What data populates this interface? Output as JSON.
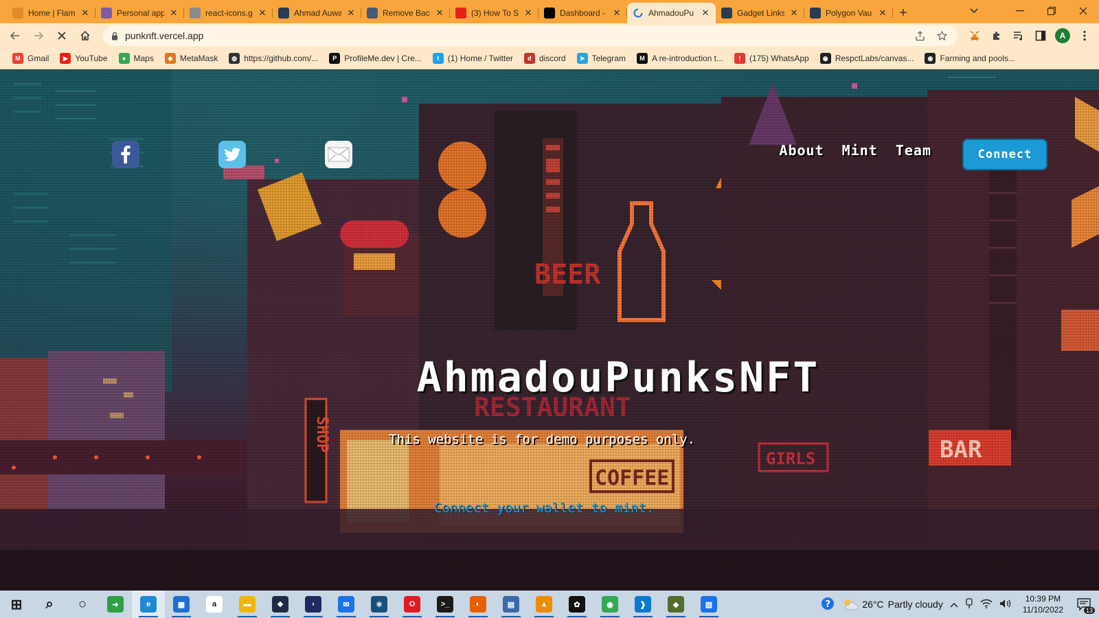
{
  "browser": {
    "tabs": [
      {
        "title": "Home | Flam",
        "favicon": "flame-favicon",
        "color": "#e08a2c",
        "active": false
      },
      {
        "title": "Personal app",
        "favicon": "h-favicon",
        "color": "#7b5ea7",
        "active": false
      },
      {
        "title": "react-icons.g",
        "favicon": "react-icons-favicon",
        "color": "#8a8a8a",
        "active": false
      },
      {
        "title": "Ahmad Auwa",
        "favicon": "gear-favicon",
        "color": "#2b3a55",
        "active": false
      },
      {
        "title": "Remove Bac",
        "favicon": "remove-bg-favicon",
        "color": "#4a5a7a",
        "active": false
      },
      {
        "title": "(3) How To S",
        "favicon": "youtube-favicon",
        "color": "#e62117",
        "active": false
      },
      {
        "title": "Dashboard -",
        "favicon": "vercel-favicon",
        "color": "#000000",
        "active": false
      },
      {
        "title": "AhmadouPu",
        "favicon": "loading-spinner",
        "color": "#1a73e8",
        "active": true
      },
      {
        "title": "Gadget Links",
        "favicon": "gear-favicon",
        "color": "#2b3a55",
        "active": false
      },
      {
        "title": "Polygon Vau",
        "favicon": "gear-favicon",
        "color": "#2b3a55",
        "active": false
      }
    ],
    "new_tab": "+",
    "url": "punknft.vercel.app",
    "profile_initial": "A",
    "bookmarks": [
      {
        "label": "Gmail",
        "icon": "gmail-icon",
        "color": "#ea4335",
        "glyph": "M"
      },
      {
        "label": "YouTube",
        "icon": "youtube-icon",
        "color": "#e62117",
        "glyph": "▶"
      },
      {
        "label": "Maps",
        "icon": "maps-icon",
        "color": "#34a853",
        "glyph": "●"
      },
      {
        "label": "MetaMask",
        "icon": "metamask-icon",
        "color": "#e2761b",
        "glyph": "◆"
      },
      {
        "label": "https://github.com/...",
        "icon": "globe-icon",
        "color": "#333333",
        "glyph": "◍"
      },
      {
        "label": "ProfileMe.dev | Cre...",
        "icon": "profileme-icon",
        "color": "#111111",
        "glyph": "P"
      },
      {
        "label": "(1) Home / Twitter",
        "icon": "twitter-icon",
        "color": "#1da1f2",
        "glyph": "t"
      },
      {
        "label": "discord",
        "icon": "discord-icon",
        "color": "#c0392b",
        "glyph": "d"
      },
      {
        "label": "Telegram",
        "icon": "telegram-icon",
        "color": "#2aa3df",
        "glyph": "➤"
      },
      {
        "label": "A re-introduction t...",
        "icon": "mdn-icon",
        "color": "#111111",
        "glyph": "M"
      },
      {
        "label": "(175) WhatsApp",
        "icon": "alert-icon",
        "color": "#e53935",
        "glyph": "!"
      },
      {
        "label": "RespctLabs/canvas...",
        "icon": "github-icon",
        "color": "#222222",
        "glyph": "◉"
      },
      {
        "label": "Farming and pools...",
        "icon": "github-icon",
        "color": "#222222",
        "glyph": "◉"
      }
    ]
  },
  "page": {
    "nav": [
      "About",
      "Mint",
      "Team"
    ],
    "connect_label": "Connect",
    "title": "AhmadouPunksNFT",
    "subtitle": "This website is for demo purposes only.",
    "cta": "Connect your wallet to mint."
  },
  "taskbar": {
    "apps": [
      {
        "name": "start-button",
        "color": "#1a1a1a",
        "glyph": "⊞"
      },
      {
        "name": "search-taskbar",
        "color": "#1a1a1a",
        "glyph": "⌕"
      },
      {
        "name": "cortana",
        "color": "#1a1a1a",
        "glyph": "○"
      },
      {
        "name": "app-green-arrow",
        "color": "#2ea043",
        "glyph": "➜"
      },
      {
        "name": "edge",
        "color": "#1f8ad2",
        "glyph": "e"
      },
      {
        "name": "ms-store",
        "color": "#1f6fd2",
        "glyph": "▦"
      },
      {
        "name": "amazon",
        "color": "#ffffff",
        "glyph": "a"
      },
      {
        "name": "file-explorer",
        "color": "#f2b705",
        "glyph": "▬"
      },
      {
        "name": "dropbox",
        "color": "#1f2a44",
        "glyph": "❖"
      },
      {
        "name": "powershell",
        "color": "#1f2a60",
        "glyph": "›"
      },
      {
        "name": "mail",
        "color": "#1a73e8",
        "glyph": "✉"
      },
      {
        "name": "react-devtools",
        "color": "#1a4f7a",
        "glyph": "⚛"
      },
      {
        "name": "opera",
        "color": "#e01b24",
        "glyph": "O"
      },
      {
        "name": "terminal",
        "color": "#1a1a1a",
        "glyph": ">_"
      },
      {
        "name": "firefox",
        "color": "#e66000",
        "glyph": "◐"
      },
      {
        "name": "network-app",
        "color": "#3a6aa8",
        "glyph": "▤"
      },
      {
        "name": "vlc",
        "color": "#f08c00",
        "glyph": "▲"
      },
      {
        "name": "app-green-circle",
        "color": "#111111",
        "glyph": "✿"
      },
      {
        "name": "chrome",
        "color": "#34a853",
        "glyph": "◉"
      },
      {
        "name": "vscode",
        "color": "#0a7acc",
        "glyph": "❱"
      },
      {
        "name": "app-chrome-profile",
        "color": "#556b2f",
        "glyph": "◈"
      },
      {
        "name": "photos",
        "color": "#1a73e8",
        "glyph": "▧"
      }
    ],
    "temperature": "26°C",
    "weather": "Partly cloudy",
    "time": "10:39 PM",
    "date": "11/10/2022",
    "notifications": "13"
  }
}
